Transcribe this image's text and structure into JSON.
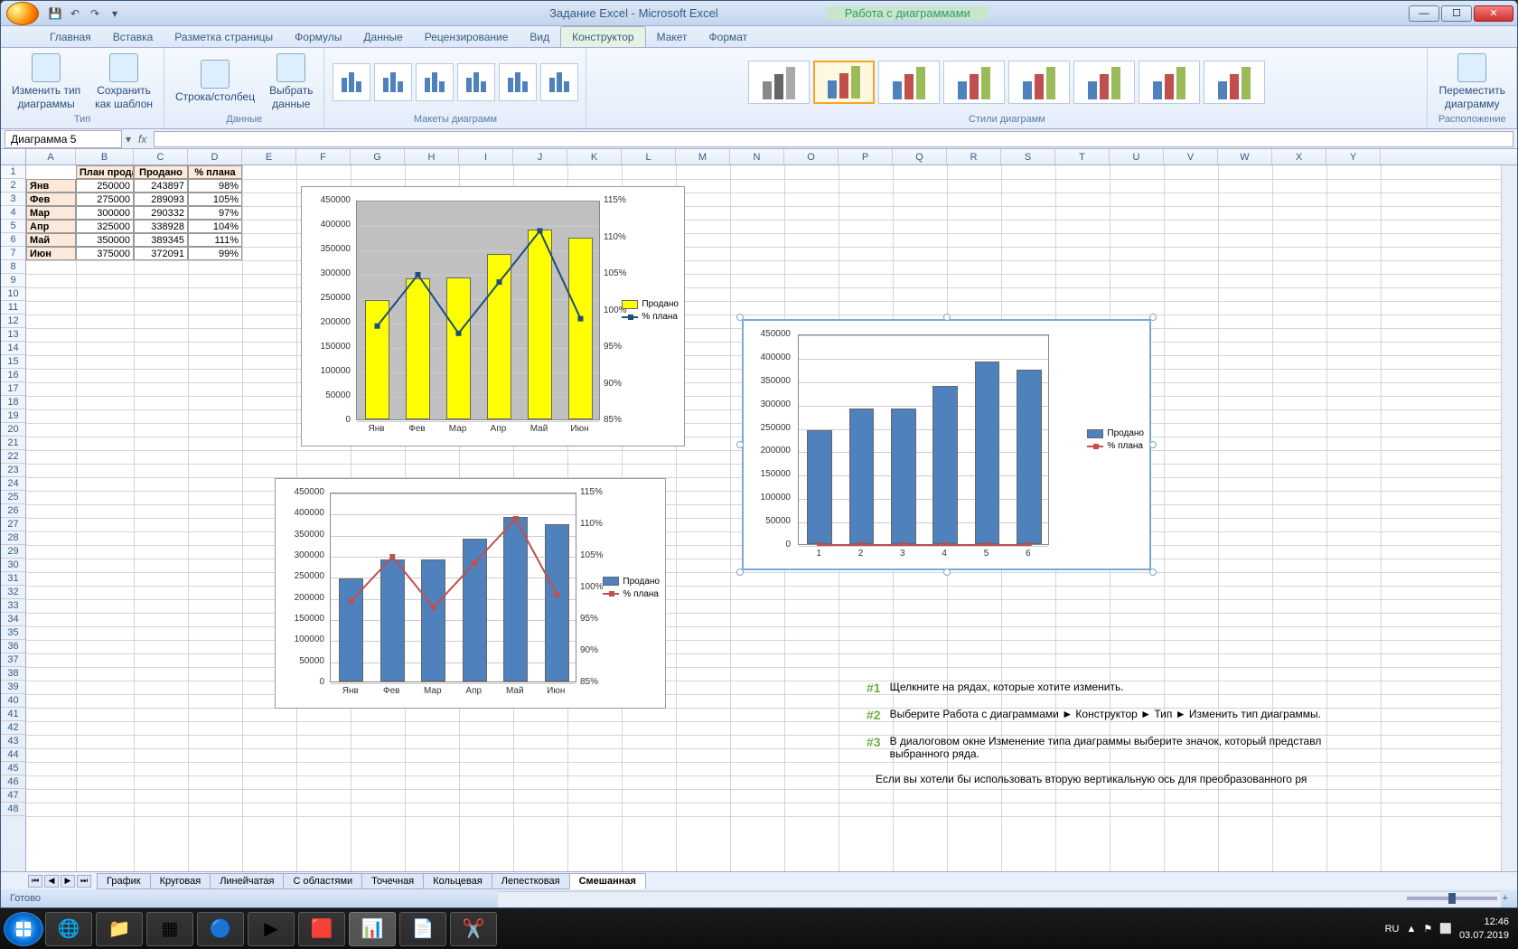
{
  "titlebar": {
    "app_title": "Задание Excel - Microsoft Excel",
    "context_title": "Работа с диаграммами"
  },
  "tabs": {
    "home": "Главная",
    "insert": "Вставка",
    "page_layout": "Разметка страницы",
    "formulas": "Формулы",
    "data": "Данные",
    "review": "Рецензирование",
    "view": "Вид",
    "design": "Конструктор",
    "layout": "Макет",
    "format": "Формат"
  },
  "ribbon": {
    "change_type": "Изменить тип\nдиаграммы",
    "save_template": "Сохранить\nкак шаблон",
    "group_type": "Тип",
    "switch_rc": "Строка/столбец",
    "select_data": "Выбрать\nданные",
    "group_data": "Данные",
    "group_layouts": "Макеты диаграмм",
    "group_styles": "Стили диаграмм",
    "move_chart": "Переместить\nдиаграмму",
    "group_location": "Расположение"
  },
  "formula": {
    "name_box": "Диаграмма 5",
    "fx": "fx"
  },
  "columns": [
    "A",
    "B",
    "C",
    "D",
    "E",
    "F",
    "G",
    "H",
    "I",
    "J",
    "K",
    "L",
    "M",
    "N",
    "O",
    "P",
    "Q",
    "R",
    "S",
    "T",
    "U",
    "V",
    "W",
    "X",
    "Y"
  ],
  "table": {
    "headers": [
      "План продаж",
      "Продано",
      "% плана"
    ],
    "rows": [
      {
        "month": "Янв",
        "plan": "250000",
        "sold": "243897",
        "pct": "98%"
      },
      {
        "month": "Фев",
        "plan": "275000",
        "sold": "289093",
        "pct": "105%"
      },
      {
        "month": "Мар",
        "plan": "300000",
        "sold": "290332",
        "pct": "97%"
      },
      {
        "month": "Апр",
        "plan": "325000",
        "sold": "338928",
        "pct": "104%"
      },
      {
        "month": "Май",
        "plan": "350000",
        "sold": "389345",
        "pct": "111%"
      },
      {
        "month": "Июн",
        "plan": "375000",
        "sold": "372091",
        "pct": "99%"
      }
    ]
  },
  "chart_data": [
    {
      "type": "bar",
      "categories": [
        "Янв",
        "Фев",
        "Мар",
        "Апр",
        "Май",
        "Июн"
      ],
      "series": [
        {
          "name": "Продано",
          "values": [
            243897,
            289093,
            290332,
            338928,
            389345,
            372091
          ],
          "color": "#ffff00",
          "axis": "primary"
        },
        {
          "name": "% плана",
          "values": [
            98,
            105,
            97,
            104,
            111,
            99
          ],
          "color": "#1f4e79",
          "axis": "secondary",
          "chart_type": "line"
        }
      ],
      "ylim": [
        0,
        450000
      ],
      "y2lim": [
        85,
        115
      ],
      "yticks": [
        "0",
        "50000",
        "100000",
        "150000",
        "200000",
        "250000",
        "300000",
        "350000",
        "400000",
        "450000"
      ],
      "y2ticks": [
        "85%",
        "90%",
        "95%",
        "100%",
        "105%",
        "110%",
        "115%"
      ],
      "plot_bg": "#c0c0c0"
    },
    {
      "type": "bar",
      "categories": [
        "Янв",
        "Фев",
        "Мар",
        "Апр",
        "Май",
        "Июн"
      ],
      "series": [
        {
          "name": "Продано",
          "values": [
            243897,
            289093,
            290332,
            338928,
            389345,
            372091
          ],
          "color": "#4f81bd",
          "axis": "primary"
        },
        {
          "name": "% плана",
          "values": [
            98,
            105,
            97,
            104,
            111,
            99
          ],
          "color": "#c0504d",
          "axis": "secondary",
          "chart_type": "line"
        }
      ],
      "ylim": [
        0,
        450000
      ],
      "y2lim": [
        85,
        115
      ],
      "yticks": [
        "0",
        "50000",
        "100000",
        "150000",
        "200000",
        "250000",
        "300000",
        "350000",
        "400000",
        "450000"
      ],
      "y2ticks": [
        "85%",
        "90%",
        "95%",
        "100%",
        "105%",
        "110%",
        "115%"
      ]
    },
    {
      "type": "bar",
      "categories": [
        "1",
        "2",
        "3",
        "4",
        "5",
        "6"
      ],
      "series": [
        {
          "name": "Продано",
          "values": [
            243897,
            289093,
            290332,
            338928,
            389345,
            372091
          ],
          "color": "#4f81bd"
        },
        {
          "name": "% плана",
          "values": [
            98,
            105,
            97,
            104,
            111,
            99
          ],
          "color": "#c0504d",
          "chart_type": "line"
        }
      ],
      "ylim": [
        0,
        450000
      ],
      "yticks": [
        "0",
        "50000",
        "100000",
        "150000",
        "200000",
        "250000",
        "300000",
        "350000",
        "400000",
        "450000"
      ]
    }
  ],
  "instructions": [
    {
      "num": "#1",
      "text": "Щелкните на рядах, которые хотите изменить."
    },
    {
      "num": "#2",
      "text": "Выберите Работа с диаграммами ► Конструктор ► Тип ► Изменить тип диаграммы."
    },
    {
      "num": "#3",
      "text": "В диалоговом окне Изменение типа диаграммы выберите значок, который представл\nвыбранного ряда."
    },
    {
      "num": "",
      "text": "Если вы хотели бы использовать вторую вертикальную ось для преобразованного ря"
    }
  ],
  "sheets": [
    "График",
    "Круговая",
    "Линейчатая",
    "С областями",
    "Точечная",
    "Кольцевая",
    "Лепестковая",
    "Смешанная"
  ],
  "active_sheet": "Смешанная",
  "status": {
    "ready": "Готово",
    "zoom": "100%"
  },
  "tray": {
    "lang": "RU",
    "time": "12:46",
    "date": "03.07.2019"
  }
}
